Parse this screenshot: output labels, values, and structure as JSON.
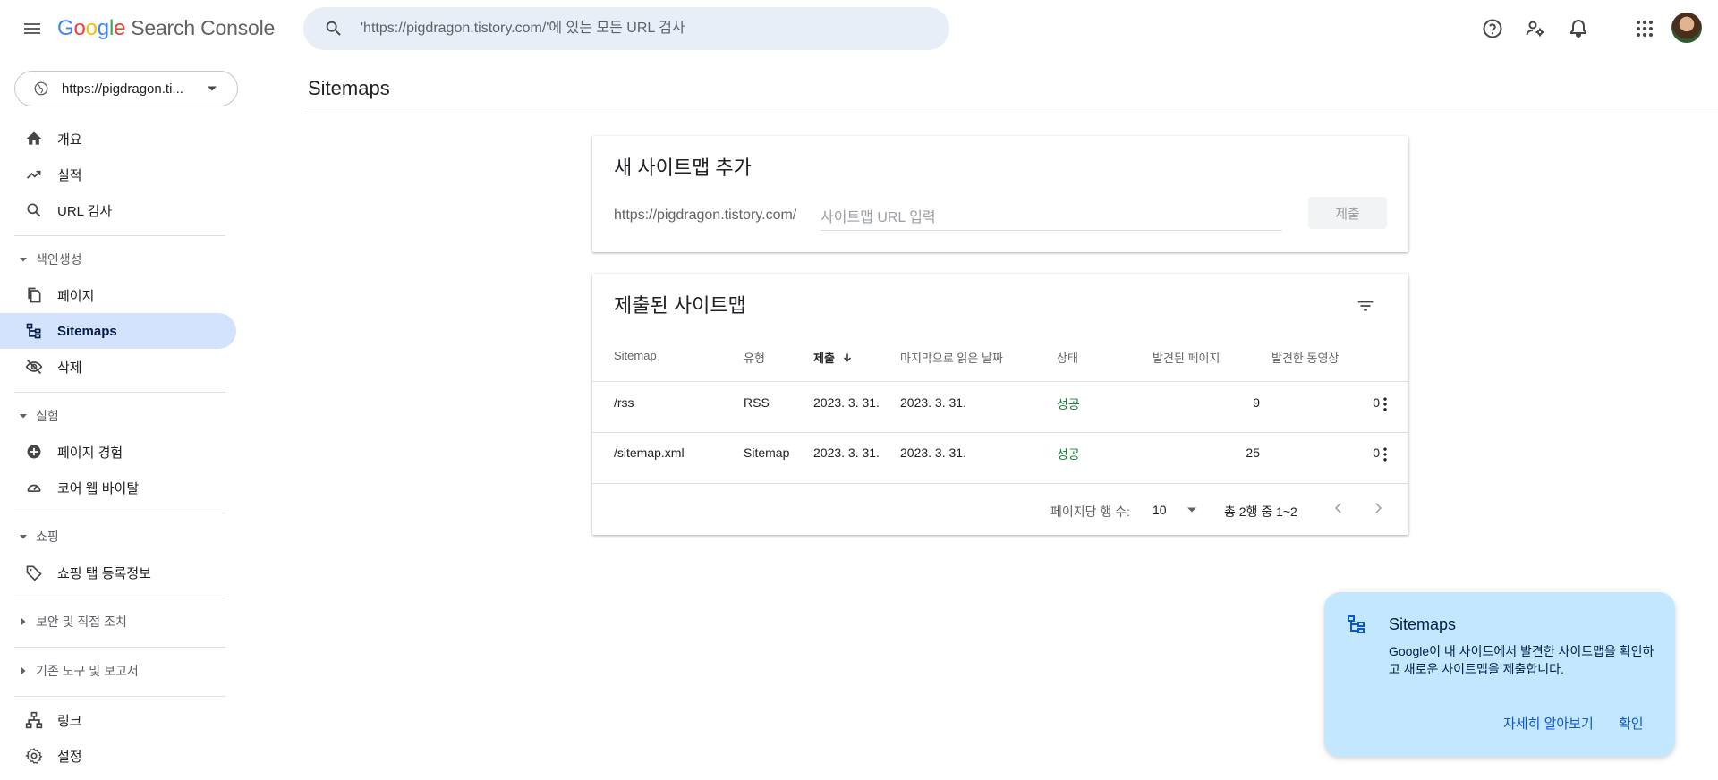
{
  "header": {
    "logo_google": "Google",
    "logo_product": "Search Console",
    "search_placeholder": "'https://pigdragon.tistory.com/'에 있는 모든 URL 검사"
  },
  "sidebar": {
    "property": "https://pigdragon.ti...",
    "items_top": [
      {
        "label": "개요",
        "icon": "home-icon"
      },
      {
        "label": "실적",
        "icon": "trending-icon"
      },
      {
        "label": "URL 검사",
        "icon": "search-icon"
      }
    ],
    "sections": {
      "indexing": "색인생성",
      "experiments": "실험",
      "shopping": "쇼핑",
      "security": "보안 및 직접 조치",
      "legacy": "기존 도구 및 보고서"
    },
    "indexing_items": [
      {
        "label": "페이지",
        "icon": "pages-icon"
      },
      {
        "label": "Sitemaps",
        "icon": "sitemap-icon",
        "active": true
      },
      {
        "label": "삭제",
        "icon": "eye-off-icon"
      }
    ],
    "experiment_items": [
      {
        "label": "페이지 경험",
        "icon": "plus-circle-icon"
      },
      {
        "label": "코어 웹 바이탈",
        "icon": "speedometer-icon"
      }
    ],
    "shopping_items": [
      {
        "label": "쇼핑 탭 등록정보",
        "icon": "tag-icon"
      }
    ],
    "bottom_items": [
      {
        "label": "링크",
        "icon": "links-icon"
      },
      {
        "label": "설정",
        "icon": "gear-icon"
      }
    ]
  },
  "main": {
    "title": "Sitemaps",
    "add_card": {
      "title": "새 사이트맵 추가",
      "prefix": "https://pigdragon.tistory.com/",
      "placeholder": "사이트맵 URL 입력",
      "submit": "제출"
    },
    "list_card": {
      "title": "제출된 사이트맵",
      "columns": [
        "Sitemap",
        "유형",
        "제출",
        "마지막으로 읽은 날짜",
        "상태",
        "발견된 페이지",
        "발견한 동영상"
      ],
      "rows": [
        {
          "sitemap": "/rss",
          "type": "RSS",
          "submitted": "2023. 3. 31.",
          "last_read": "2023. 3. 31.",
          "status": "성공",
          "pages": "9",
          "videos": "0"
        },
        {
          "sitemap": "/sitemap.xml",
          "type": "Sitemap",
          "submitted": "2023. 3. 31.",
          "last_read": "2023. 3. 31.",
          "status": "성공",
          "pages": "25",
          "videos": "0"
        }
      ],
      "rows_per_page_label": "페이지당 행 수:",
      "rows_per_page": "10",
      "range": "총 2행 중 1~2"
    }
  },
  "help_card": {
    "title": "Sitemaps",
    "body": "Google이 내 사이트에서 발견한 사이트맵을 확인하고 새로운 사이트맵을 제출합니다.",
    "learn_more": "자세히 알아보기",
    "ok": "확인"
  },
  "colors": {
    "accent": "#0b57d0",
    "active_nav": "#d3e3fd",
    "success": "#188038",
    "help_bg": "#c2e7ff"
  }
}
